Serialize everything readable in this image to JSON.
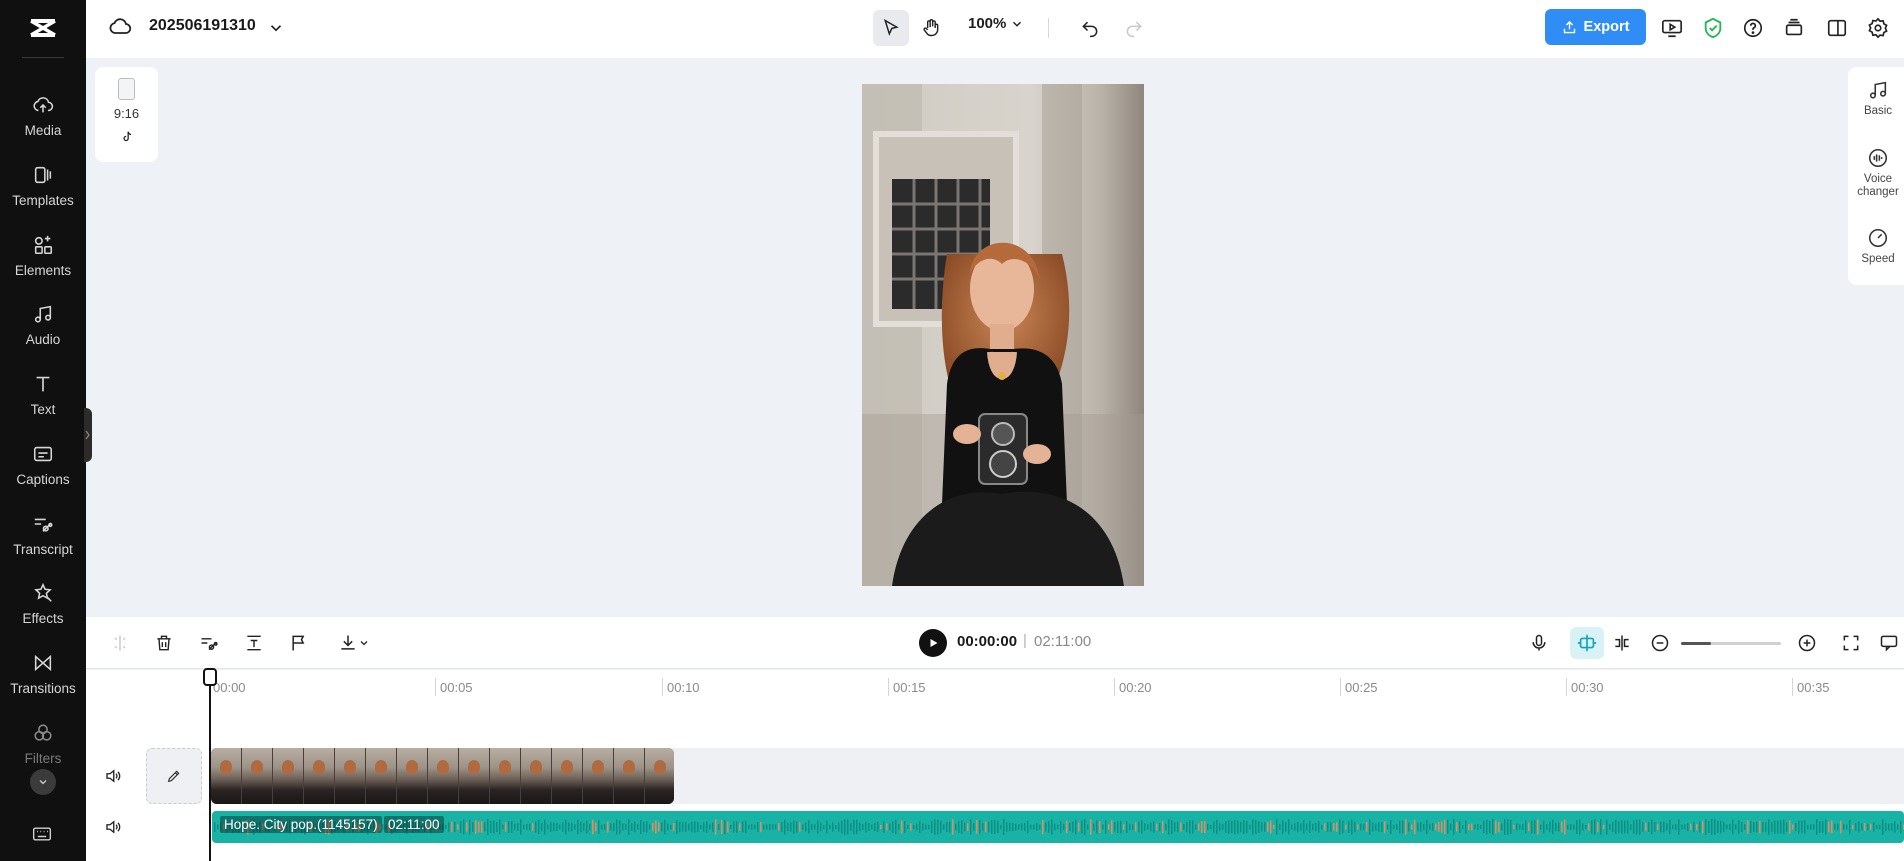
{
  "project": {
    "name": "202506191310"
  },
  "toolbar": {
    "zoom": "100%",
    "export_label": "Export"
  },
  "sidebar": {
    "items": [
      {
        "label": "Media",
        "icon": "cloud-upload-icon"
      },
      {
        "label": "Templates",
        "icon": "templates-icon"
      },
      {
        "label": "Elements",
        "icon": "elements-icon"
      },
      {
        "label": "Audio",
        "icon": "music-note-icon"
      },
      {
        "label": "Text",
        "icon": "text-icon"
      },
      {
        "label": "Captions",
        "icon": "captions-icon"
      },
      {
        "label": "Transcript",
        "icon": "transcript-icon"
      },
      {
        "label": "Effects",
        "icon": "effects-icon"
      },
      {
        "label": "Transitions",
        "icon": "transitions-icon"
      },
      {
        "label": "Filters",
        "icon": "filters-icon"
      }
    ]
  },
  "canvas": {
    "aspect_ratio": "9:16",
    "platform_icon": "tiktok-icon"
  },
  "right_panel": {
    "items": [
      {
        "label": "Basic",
        "icon": "music-note-icon"
      },
      {
        "label": "Voice changer",
        "icon": "voice-changer-icon"
      },
      {
        "label": "Speed",
        "icon": "speed-icon"
      }
    ]
  },
  "playback": {
    "current_time": "00:00:00",
    "separator": "|",
    "total_time": "02:11:00"
  },
  "timeline": {
    "ruler": [
      "00:00",
      "00:05",
      "00:10",
      "00:15",
      "00:20",
      "00:25",
      "00:30",
      "00:35"
    ],
    "zoom_level": 0.3,
    "audio_clip": {
      "name": "Hope. City pop.(1145157)",
      "duration": "02:11:00"
    }
  },
  "colors": {
    "accent": "#2f8df5",
    "audio_track": "#19b3a6",
    "sidebar_bg": "#101010",
    "shield": "#1db954"
  }
}
